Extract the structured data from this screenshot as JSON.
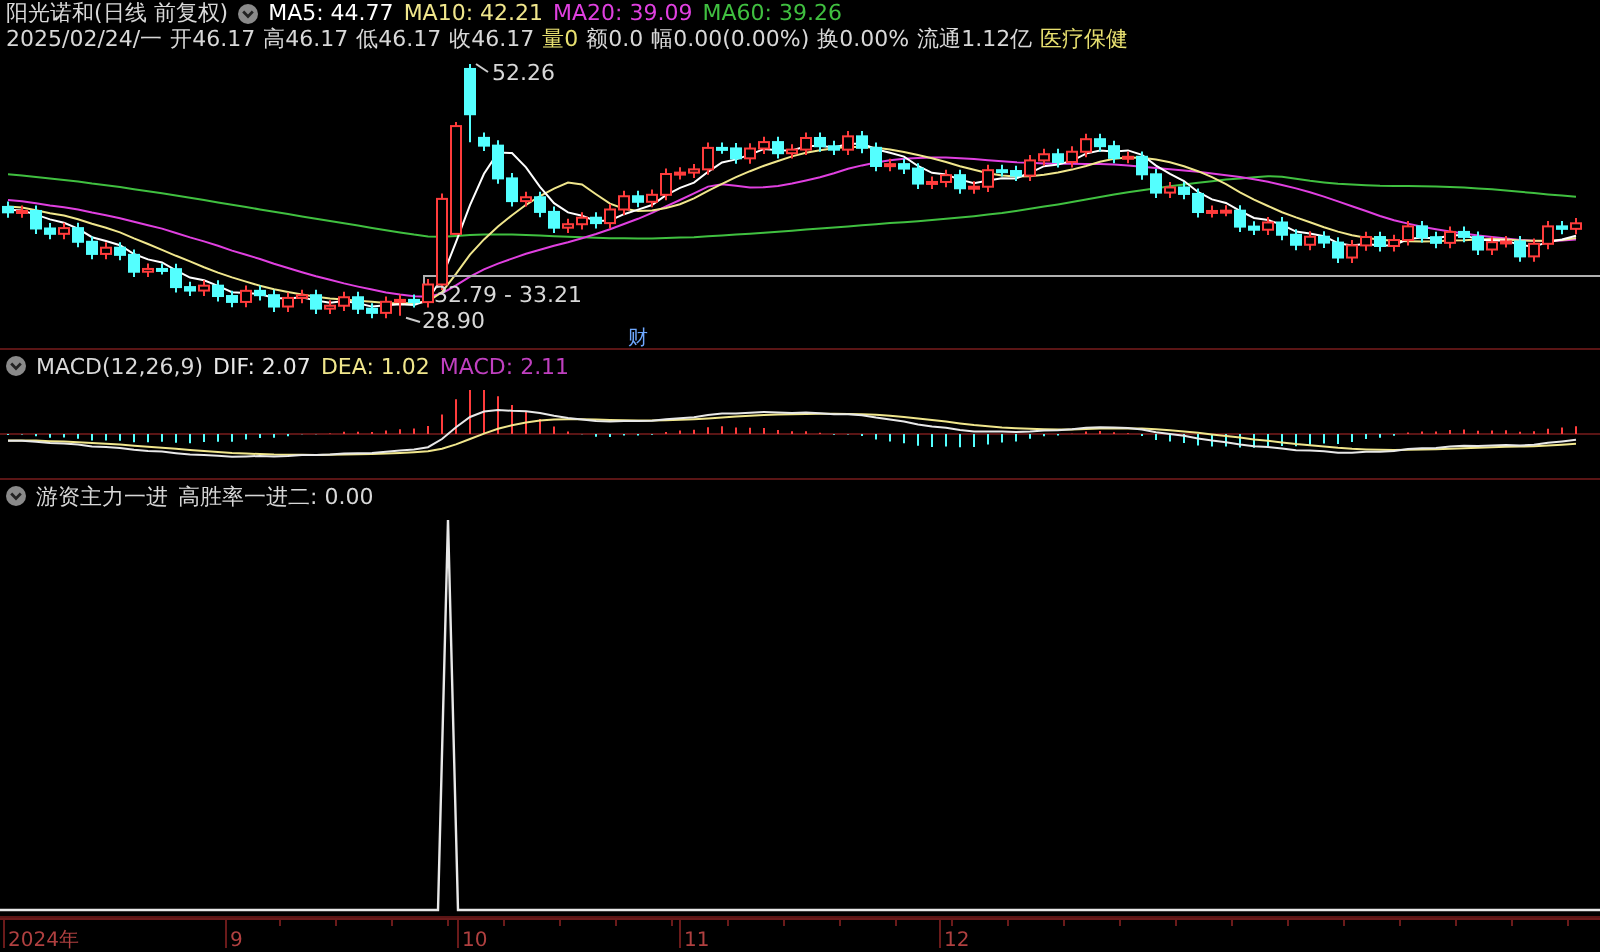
{
  "header": {
    "title": "阳光诺和(日线 前复权)",
    "ma": [
      {
        "label": "MA5: 44.77",
        "color": "#ffffff"
      },
      {
        "label": "MA10: 42.21",
        "color": "#f0e68c"
      },
      {
        "label": "MA20: 39.09",
        "color": "#e040e0"
      },
      {
        "label": "MA60: 39.26",
        "color": "#40c040"
      }
    ]
  },
  "quote": {
    "date": "2025/02/24/一",
    "fields": [
      {
        "text": "开46.17",
        "color": "#d8d8d8"
      },
      {
        "text": "高46.17",
        "color": "#d8d8d8"
      },
      {
        "text": "低46.17",
        "color": "#d8d8d8"
      },
      {
        "text": "收46.17",
        "color": "#d8d8d8"
      },
      {
        "text": "量0",
        "color": "#e8e070"
      },
      {
        "text": "额0.0",
        "color": "#d8d8d8"
      },
      {
        "text": "幅0.00(0.00%)",
        "color": "#d8d8d8"
      },
      {
        "text": "换0.00%",
        "color": "#d8d8d8"
      },
      {
        "text": "流通1.12亿",
        "color": "#d8d8d8"
      },
      {
        "text": "医疗保健",
        "color": "#e8e070"
      }
    ]
  },
  "main_chart": {
    "high_label": "52.26",
    "low_label": "28.90",
    "range_label": "32.79 - 33.21",
    "marker": "财"
  },
  "macd": {
    "title": "MACD(12,26,9)",
    "values": [
      {
        "label": "DIF: 2.07",
        "color": "#e8e8e8"
      },
      {
        "label": "DEA: 1.02",
        "color": "#f0e68c"
      },
      {
        "label": "MACD: 2.11",
        "color": "#c040c0"
      }
    ]
  },
  "indicator": {
    "title": "游资主力一进",
    "value": "高胜率一进二: 0.00"
  },
  "x_axis": {
    "labels": [
      "2024年",
      "9",
      "10",
      "11",
      "12"
    ]
  }
}
